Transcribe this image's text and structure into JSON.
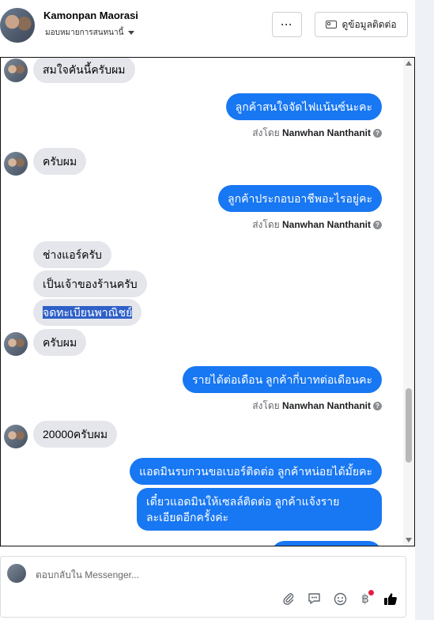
{
  "header": {
    "name": "Kamonpan Maorasi",
    "assign_label": "มอบหมายการสนทนานี้",
    "more_label": "···",
    "contact_button": "ดูข้อมูลติดต่อ"
  },
  "messages": [
    {
      "dir": "in",
      "text": "สมใจคันนี้ครับผม"
    },
    {
      "dir": "out",
      "text": "ลูกค้าสนใจจัดไฟแน้นซ์นะคะ",
      "sent_prefix": "ส่งโดย",
      "sender": "Nanwhan Nanthanit"
    },
    {
      "dir": "in",
      "text": "ครับผม"
    },
    {
      "dir": "out",
      "text": "ลูกค้าประกอบอาชีพอะไรอยู่คะ",
      "sent_prefix": "ส่งโดย",
      "sender": "Nanwhan Nanthanit"
    },
    {
      "dir": "in",
      "text": "ช่างแอร์ครับ"
    },
    {
      "dir": "in",
      "text": "เป็นเจ้าของร้านครับ"
    },
    {
      "dir": "in",
      "text": "จดทะเบียนพาณิชย์"
    },
    {
      "dir": "in",
      "text": "ครับผม"
    },
    {
      "dir": "out",
      "text": "รายได้ต่อเดือน ลูกค้ากี่บาทต่อเดือนคะ",
      "sent_prefix": "ส่งโดย",
      "sender": "Nanwhan Nanthanit"
    },
    {
      "dir": "in",
      "text": "20000ครับผม"
    },
    {
      "dir": "out",
      "text": "แอดมินรบกวนขอเบอร์ติดต่อ ลูกค้าหน่อยได้มั้ยคะ"
    },
    {
      "dir": "out",
      "text": "เดี๋ยวแอดมินให้เซลล์ติดต่อ ลูกค้าแจ้งรายละเอียดอีกครั้งค่ะ"
    }
  ],
  "composer": {
    "placeholder": "ตอบกลับใน Messenger..."
  },
  "icons": {
    "attach": "paperclip-icon",
    "gif": "chat-bubble-icon",
    "emoji": "smiley-icon",
    "payment": "baht-icon",
    "like": "thumbs-up-icon"
  },
  "colors": {
    "outgoing": "#1877f2",
    "incoming": "#e4e6eb",
    "selection": "#2f60c8",
    "notification": "#e41e3f"
  }
}
